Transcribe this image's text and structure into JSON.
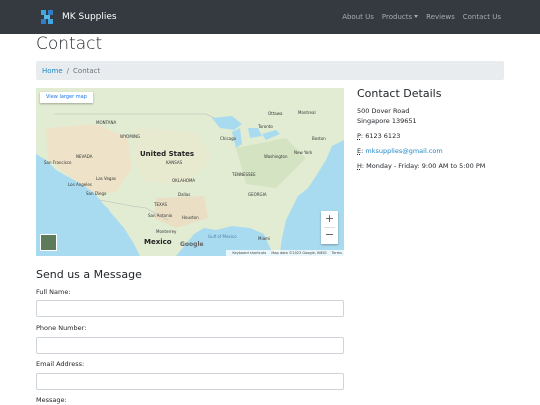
{
  "navbar": {
    "brand": "MK Supplies",
    "links": [
      {
        "label": "About Us"
      },
      {
        "label": "Products"
      },
      {
        "label": "Reviews"
      },
      {
        "label": "Contact Us"
      }
    ]
  },
  "page": {
    "title": "Contact"
  },
  "breadcrumb": {
    "home": "Home",
    "separator": "/",
    "current": "Contact"
  },
  "map": {
    "larger_map_button": "View larger map",
    "zoom_in": "+",
    "zoom_out": "−",
    "google": "Google",
    "attribution": {
      "shortcuts": "Keyboard shortcuts",
      "data": "Map data ©2023 Google, INEGI",
      "terms": "Terms"
    },
    "labels": {
      "country_us": "United States",
      "country_mexico": "Mexico",
      "gulf": "Gulf of Mexico",
      "ottawa": "Ottawa",
      "montreal": "Montreal",
      "toronto": "Toronto",
      "boston": "Boston",
      "chicago": "Chicago",
      "new_york": "New York",
      "washington": "Washington",
      "san_francisco": "San Francisco",
      "las_vegas": "Las Vegas",
      "los_angeles": "Los Angeles",
      "san_diego": "San Diego",
      "dallas": "Dallas",
      "houston": "Houston",
      "san_antonio": "San Antonio",
      "monterrey": "Monterrey",
      "miami": "Miami",
      "oklahoma": "OKLAHOMA",
      "wyoming": "WYOMING",
      "nevada": "NEVADA",
      "montana": "MONTANA",
      "kansas": "KANSAS",
      "texas": "TEXAS",
      "georgia": "GEORGIA",
      "tennessee": "TENNESSEE"
    }
  },
  "contact": {
    "title": "Contact Details",
    "address_line1": "500 Dover Road",
    "address_line2": "Singapore 139651",
    "phone_abbr": "P",
    "phone": "6123 6123",
    "email_abbr": "E",
    "email": "mksupplies@gmail.com",
    "hours_abbr": "H",
    "hours": "Monday - Friday: 9:00 AM to 5:00 PM"
  },
  "form": {
    "title": "Send us a Message",
    "full_name_label": "Full Name:",
    "phone_label": "Phone Number:",
    "email_label": "Email Address:",
    "message_label": "Message:"
  },
  "colors": {
    "navbar_bg": "#343a40",
    "link": "#1e88c8",
    "breadcrumb_bg": "#e9ecef",
    "water": "#a9dbf0",
    "land": "#e2ecd3"
  }
}
